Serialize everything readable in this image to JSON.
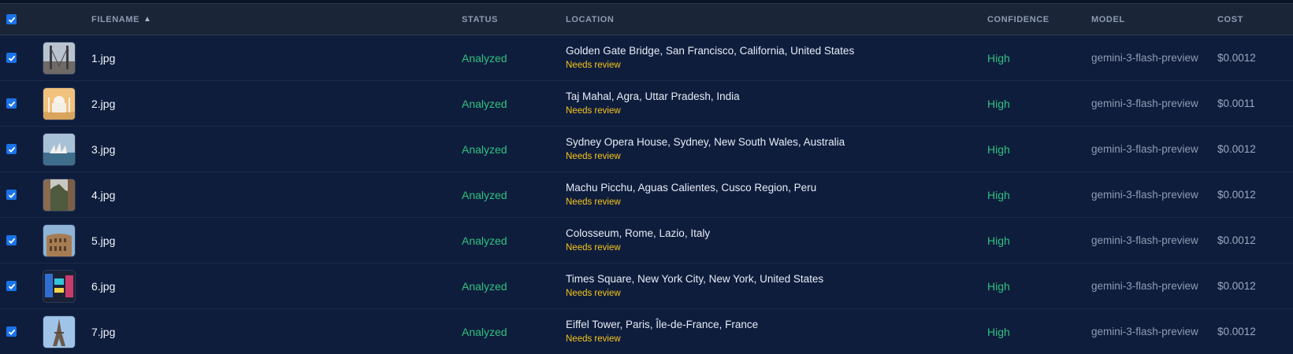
{
  "header": {
    "filename": "FILENAME",
    "status": "STATUS",
    "location": "LOCATION",
    "confidence": "CONFIDENCE",
    "model": "MODEL",
    "cost": "COST"
  },
  "sort_indicator": "▲",
  "rows": [
    {
      "filename": "1.jpg",
      "status": "Analyzed",
      "location": "Golden Gate Bridge, San Francisco, California, United States",
      "flag": "Needs review",
      "confidence": "High",
      "model": "gemini-3-flash-preview",
      "cost": "$0.0012",
      "thumb": "bridge"
    },
    {
      "filename": "2.jpg",
      "status": "Analyzed",
      "location": "Taj Mahal, Agra, Uttar Pradesh, India",
      "flag": "Needs review",
      "confidence": "High",
      "model": "gemini-3-flash-preview",
      "cost": "$0.0011",
      "thumb": "taj"
    },
    {
      "filename": "3.jpg",
      "status": "Analyzed",
      "location": "Sydney Opera House, Sydney, New South Wales, Australia",
      "flag": "Needs review",
      "confidence": "High",
      "model": "gemini-3-flash-preview",
      "cost": "$0.0012",
      "thumb": "opera"
    },
    {
      "filename": "4.jpg",
      "status": "Analyzed",
      "location": "Machu Picchu, Aguas Calientes, Cusco Region, Peru",
      "flag": "Needs review",
      "confidence": "High",
      "model": "gemini-3-flash-preview",
      "cost": "$0.0012",
      "thumb": "machu"
    },
    {
      "filename": "5.jpg",
      "status": "Analyzed",
      "location": "Colosseum, Rome, Lazio, Italy",
      "flag": "Needs review",
      "confidence": "High",
      "model": "gemini-3-flash-preview",
      "cost": "$0.0012",
      "thumb": "colosseum"
    },
    {
      "filename": "6.jpg",
      "status": "Analyzed",
      "location": "Times Square, New York City, New York, United States",
      "flag": "Needs review",
      "confidence": "High",
      "model": "gemini-3-flash-preview",
      "cost": "$0.0012",
      "thumb": "times"
    },
    {
      "filename": "7.jpg",
      "status": "Analyzed",
      "location": "Eiffel Tower, Paris, Île-de-France, France",
      "flag": "Needs review",
      "confidence": "High",
      "model": "gemini-3-flash-preview",
      "cost": "$0.0012",
      "thumb": "eiffel"
    }
  ],
  "colors": {
    "accent": "#1a73e8",
    "status_green": "#2ec27e",
    "flag_yellow": "#f5c518",
    "row_bg": "#0f1d3d",
    "header_bg": "#1a2537"
  }
}
